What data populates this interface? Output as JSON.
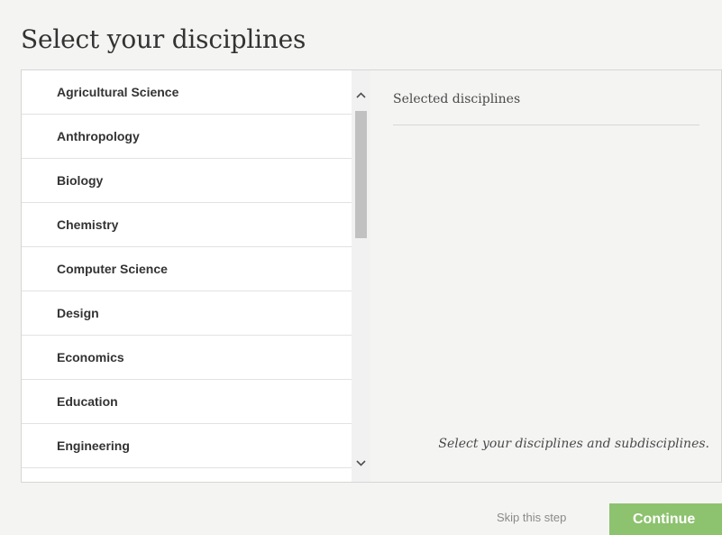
{
  "title": "Select your disciplines",
  "disciplines": [
    {
      "label": "Agricultural Science"
    },
    {
      "label": "Anthropology"
    },
    {
      "label": "Biology"
    },
    {
      "label": "Chemistry"
    },
    {
      "label": "Computer Science"
    },
    {
      "label": "Design"
    },
    {
      "label": "Economics"
    },
    {
      "label": "Education"
    },
    {
      "label": "Engineering"
    }
  ],
  "selected_panel": {
    "header": "Selected disciplines",
    "hint": "Select your disciplines and subdisciplines."
  },
  "footer": {
    "skip_label": "Skip this step",
    "continue_label": "Continue"
  },
  "colors": {
    "continue_button": "#8dc26f",
    "background": "#f4f4f3"
  },
  "icons": {
    "scroll_up": "chevron-up-icon",
    "scroll_down": "chevron-down-icon"
  }
}
